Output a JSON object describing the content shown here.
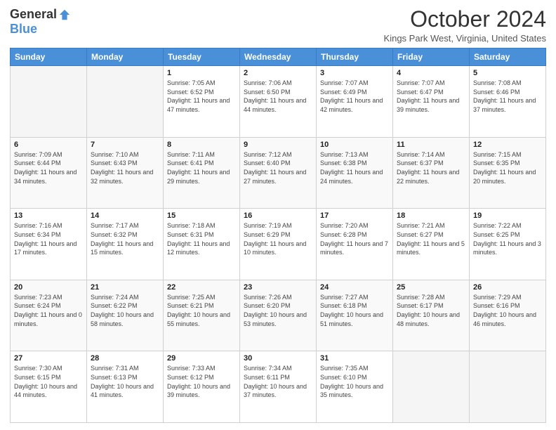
{
  "logo": {
    "general": "General",
    "blue": "Blue"
  },
  "title": "October 2024",
  "location": "Kings Park West, Virginia, United States",
  "days_of_week": [
    "Sunday",
    "Monday",
    "Tuesday",
    "Wednesday",
    "Thursday",
    "Friday",
    "Saturday"
  ],
  "weeks": [
    [
      {
        "day": "",
        "info": ""
      },
      {
        "day": "",
        "info": ""
      },
      {
        "day": "1",
        "info": "Sunrise: 7:05 AM\nSunset: 6:52 PM\nDaylight: 11 hours and 47 minutes."
      },
      {
        "day": "2",
        "info": "Sunrise: 7:06 AM\nSunset: 6:50 PM\nDaylight: 11 hours and 44 minutes."
      },
      {
        "day": "3",
        "info": "Sunrise: 7:07 AM\nSunset: 6:49 PM\nDaylight: 11 hours and 42 minutes."
      },
      {
        "day": "4",
        "info": "Sunrise: 7:07 AM\nSunset: 6:47 PM\nDaylight: 11 hours and 39 minutes."
      },
      {
        "day": "5",
        "info": "Sunrise: 7:08 AM\nSunset: 6:46 PM\nDaylight: 11 hours and 37 minutes."
      }
    ],
    [
      {
        "day": "6",
        "info": "Sunrise: 7:09 AM\nSunset: 6:44 PM\nDaylight: 11 hours and 34 minutes."
      },
      {
        "day": "7",
        "info": "Sunrise: 7:10 AM\nSunset: 6:43 PM\nDaylight: 11 hours and 32 minutes."
      },
      {
        "day": "8",
        "info": "Sunrise: 7:11 AM\nSunset: 6:41 PM\nDaylight: 11 hours and 29 minutes."
      },
      {
        "day": "9",
        "info": "Sunrise: 7:12 AM\nSunset: 6:40 PM\nDaylight: 11 hours and 27 minutes."
      },
      {
        "day": "10",
        "info": "Sunrise: 7:13 AM\nSunset: 6:38 PM\nDaylight: 11 hours and 24 minutes."
      },
      {
        "day": "11",
        "info": "Sunrise: 7:14 AM\nSunset: 6:37 PM\nDaylight: 11 hours and 22 minutes."
      },
      {
        "day": "12",
        "info": "Sunrise: 7:15 AM\nSunset: 6:35 PM\nDaylight: 11 hours and 20 minutes."
      }
    ],
    [
      {
        "day": "13",
        "info": "Sunrise: 7:16 AM\nSunset: 6:34 PM\nDaylight: 11 hours and 17 minutes."
      },
      {
        "day": "14",
        "info": "Sunrise: 7:17 AM\nSunset: 6:32 PM\nDaylight: 11 hours and 15 minutes."
      },
      {
        "day": "15",
        "info": "Sunrise: 7:18 AM\nSunset: 6:31 PM\nDaylight: 11 hours and 12 minutes."
      },
      {
        "day": "16",
        "info": "Sunrise: 7:19 AM\nSunset: 6:29 PM\nDaylight: 11 hours and 10 minutes."
      },
      {
        "day": "17",
        "info": "Sunrise: 7:20 AM\nSunset: 6:28 PM\nDaylight: 11 hours and 7 minutes."
      },
      {
        "day": "18",
        "info": "Sunrise: 7:21 AM\nSunset: 6:27 PM\nDaylight: 11 hours and 5 minutes."
      },
      {
        "day": "19",
        "info": "Sunrise: 7:22 AM\nSunset: 6:25 PM\nDaylight: 11 hours and 3 minutes."
      }
    ],
    [
      {
        "day": "20",
        "info": "Sunrise: 7:23 AM\nSunset: 6:24 PM\nDaylight: 11 hours and 0 minutes."
      },
      {
        "day": "21",
        "info": "Sunrise: 7:24 AM\nSunset: 6:22 PM\nDaylight: 10 hours and 58 minutes."
      },
      {
        "day": "22",
        "info": "Sunrise: 7:25 AM\nSunset: 6:21 PM\nDaylight: 10 hours and 55 minutes."
      },
      {
        "day": "23",
        "info": "Sunrise: 7:26 AM\nSunset: 6:20 PM\nDaylight: 10 hours and 53 minutes."
      },
      {
        "day": "24",
        "info": "Sunrise: 7:27 AM\nSunset: 6:18 PM\nDaylight: 10 hours and 51 minutes."
      },
      {
        "day": "25",
        "info": "Sunrise: 7:28 AM\nSunset: 6:17 PM\nDaylight: 10 hours and 48 minutes."
      },
      {
        "day": "26",
        "info": "Sunrise: 7:29 AM\nSunset: 6:16 PM\nDaylight: 10 hours and 46 minutes."
      }
    ],
    [
      {
        "day": "27",
        "info": "Sunrise: 7:30 AM\nSunset: 6:15 PM\nDaylight: 10 hours and 44 minutes."
      },
      {
        "day": "28",
        "info": "Sunrise: 7:31 AM\nSunset: 6:13 PM\nDaylight: 10 hours and 41 minutes."
      },
      {
        "day": "29",
        "info": "Sunrise: 7:33 AM\nSunset: 6:12 PM\nDaylight: 10 hours and 39 minutes."
      },
      {
        "day": "30",
        "info": "Sunrise: 7:34 AM\nSunset: 6:11 PM\nDaylight: 10 hours and 37 minutes."
      },
      {
        "day": "31",
        "info": "Sunrise: 7:35 AM\nSunset: 6:10 PM\nDaylight: 10 hours and 35 minutes."
      },
      {
        "day": "",
        "info": ""
      },
      {
        "day": "",
        "info": ""
      }
    ]
  ]
}
